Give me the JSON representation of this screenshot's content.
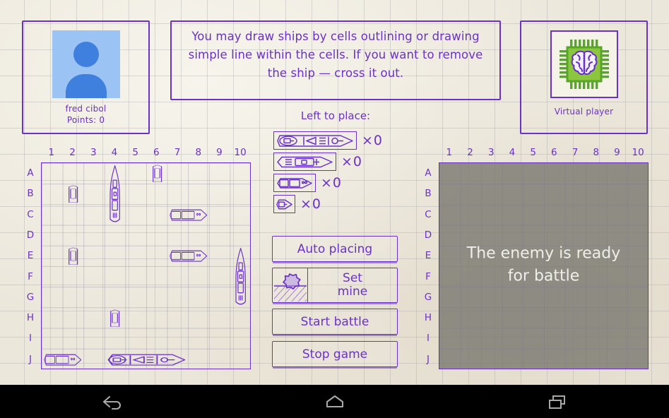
{
  "player": {
    "name": "fred cibol",
    "points_label": "Points: 0",
    "avatar_icon": "person-avatar-icon"
  },
  "hint": {
    "text": "You may draw ships by cells outlining or drawing simple line within the cells. If you want to remove the ship — cross it out."
  },
  "virtual_player": {
    "name": "Virtual player",
    "icon": "cpu-brain-icon"
  },
  "fleet": {
    "title": "Left to place:",
    "ships": [
      {
        "name": "battleship-4",
        "cells": 4,
        "count_label": "×0"
      },
      {
        "name": "cruiser-3",
        "cells": 3,
        "count_label": "×0"
      },
      {
        "name": "destroyer-2",
        "cells": 2,
        "count_label": "×0"
      },
      {
        "name": "submarine-1",
        "cells": 1,
        "count_label": "×0"
      }
    ]
  },
  "buttons": {
    "auto_placing": "Auto placing",
    "set_mine_line1": "Set",
    "set_mine_line2": "mine",
    "set_mine_icon": "sea-mine-icon",
    "start_battle": "Start battle",
    "stop_game": "Stop game"
  },
  "boards": {
    "columns": [
      "1",
      "2",
      "3",
      "4",
      "5",
      "6",
      "7",
      "8",
      "9",
      "10"
    ],
    "rows": [
      "A",
      "B",
      "C",
      "D",
      "E",
      "F",
      "G",
      "H",
      "I",
      "J"
    ],
    "player_board": {
      "name": "player-board",
      "ships": [
        {
          "kind": "cruiser-3",
          "size": 3,
          "orient": "v",
          "col": 4,
          "row": 1
        },
        {
          "kind": "submarine-1",
          "size": 1,
          "orient": "v",
          "col": 6,
          "row": 1
        },
        {
          "kind": "submarine-1",
          "size": 1,
          "orient": "v",
          "col": 2,
          "row": 2
        },
        {
          "kind": "destroyer-2",
          "size": 2,
          "orient": "h",
          "col": 7,
          "row": 3
        },
        {
          "kind": "submarine-1",
          "size": 1,
          "orient": "v",
          "col": 2,
          "row": 5
        },
        {
          "kind": "destroyer-2",
          "size": 2,
          "orient": "h",
          "col": 7,
          "row": 5
        },
        {
          "kind": "cruiser-3",
          "size": 3,
          "orient": "v",
          "col": 10,
          "row": 5
        },
        {
          "kind": "submarine-1",
          "size": 1,
          "orient": "v",
          "col": 4,
          "row": 8
        },
        {
          "kind": "destroyer-2",
          "size": 2,
          "orient": "h",
          "col": 1,
          "row": 10
        },
        {
          "kind": "battleship-4",
          "size": 4,
          "orient": "h",
          "col": 4,
          "row": 10
        }
      ]
    },
    "enemy_board": {
      "name": "enemy-board",
      "status_message": "The enemy is ready for battle",
      "disabled": true
    }
  },
  "navbar": {
    "back": "back-icon",
    "home": "home-icon",
    "recents": "recent-apps-icon"
  },
  "colors": {
    "ink": "#6A33C6",
    "paper": "#ECE7DB",
    "avatar_bg": "#9BC4F5",
    "avatar_fg": "#3F7FDE",
    "enemy_overlay": "#807E76",
    "chip_green": "#56A627"
  }
}
